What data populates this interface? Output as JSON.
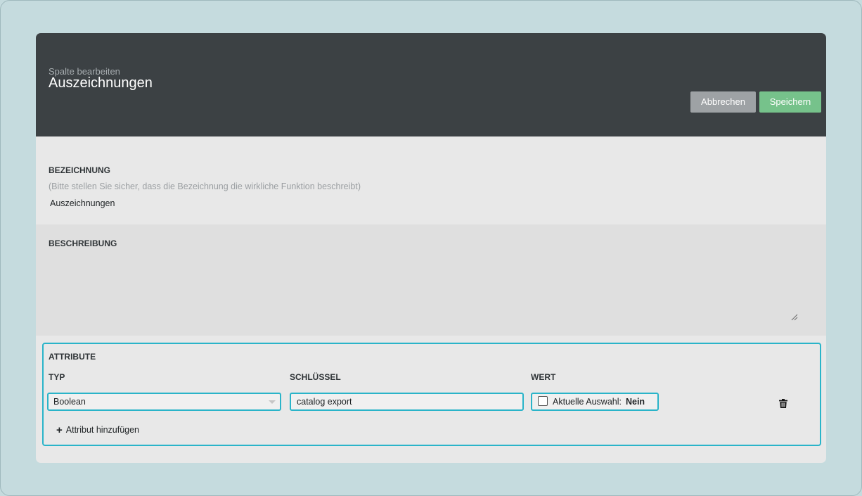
{
  "header": {
    "subtitle": "Spalte bearbeiten",
    "title": "Auszeichnungen",
    "cancel_label": "Abbrechen",
    "save_label": "Speichern"
  },
  "name_section": {
    "label": "BEZEICHNUNG",
    "hint": "(Bitte stellen Sie sicher, dass die Bezeichnung die wirkliche Funktion beschreibt)",
    "value": "Auszeichnungen"
  },
  "description_section": {
    "label": "BESCHREIBUNG",
    "value": ""
  },
  "attributes": {
    "title": "ATTRIBUTE",
    "columns": {
      "type": "TYP",
      "key": "SCHLÜSSEL",
      "value": "WERT"
    },
    "rows": [
      {
        "type": "Boolean",
        "key": "catalog export",
        "value_label": "Aktuelle Auswahl:",
        "value": "Nein",
        "checked": false
      }
    ],
    "add_label": "Attribut hinzufügen"
  },
  "colors": {
    "background": "#c5dbde",
    "header": "#3c4144",
    "accent": "#2ab4c9",
    "save": "#76c28b",
    "cancel": "#9ea2a5"
  },
  "icons": [
    "plus-icon",
    "trash-icon",
    "resize-handle-icon",
    "chevron-down-icon"
  ]
}
